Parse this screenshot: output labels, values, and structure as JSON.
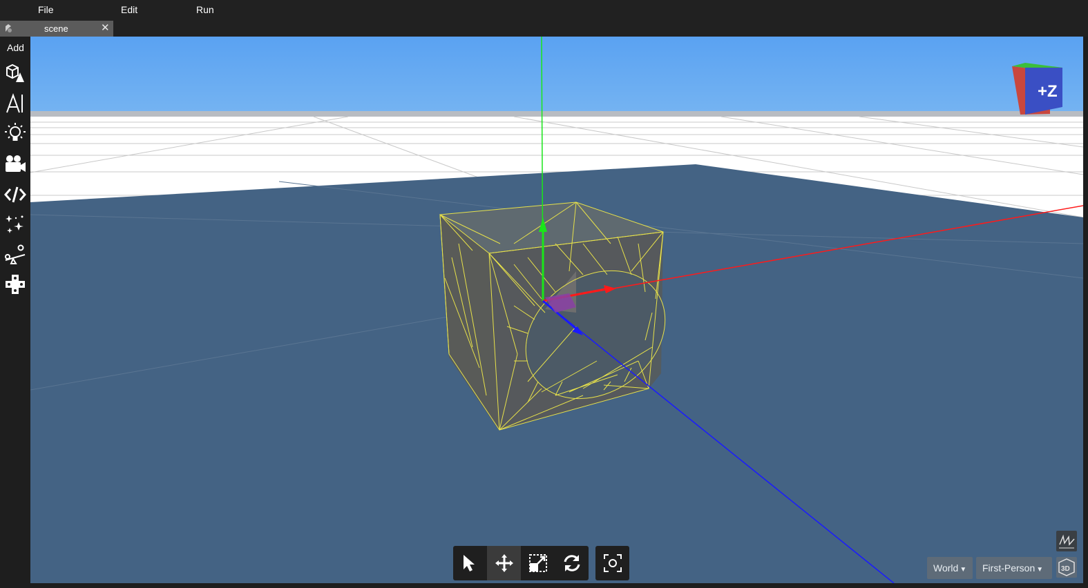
{
  "menu": {
    "file": "File",
    "edit": "Edit",
    "run": "Run"
  },
  "tabs": [
    {
      "label": "scene",
      "close": "✕"
    }
  ],
  "sidebar": {
    "add_label": "Add",
    "tools": [
      "shapes-icon",
      "text-icon",
      "light-icon",
      "camera-icon",
      "code-icon",
      "effects-icon",
      "physics-icon",
      "gamepad-icon"
    ]
  },
  "viewport": {
    "gizmo_label": "+Z",
    "space_select": "World",
    "camera_select": "First-Person",
    "colors": {
      "sky_top": "#5aa2f2",
      "ground_plane": "#446384",
      "wireframe": "#e8e24a",
      "x_axis": "#ff1a1a",
      "y_axis": "#19e619",
      "z_axis": "#1a1aff"
    }
  },
  "transform_tools": [
    "select-icon",
    "move-icon",
    "scale-icon",
    "rotate-icon"
  ],
  "active_tool": "move-icon"
}
